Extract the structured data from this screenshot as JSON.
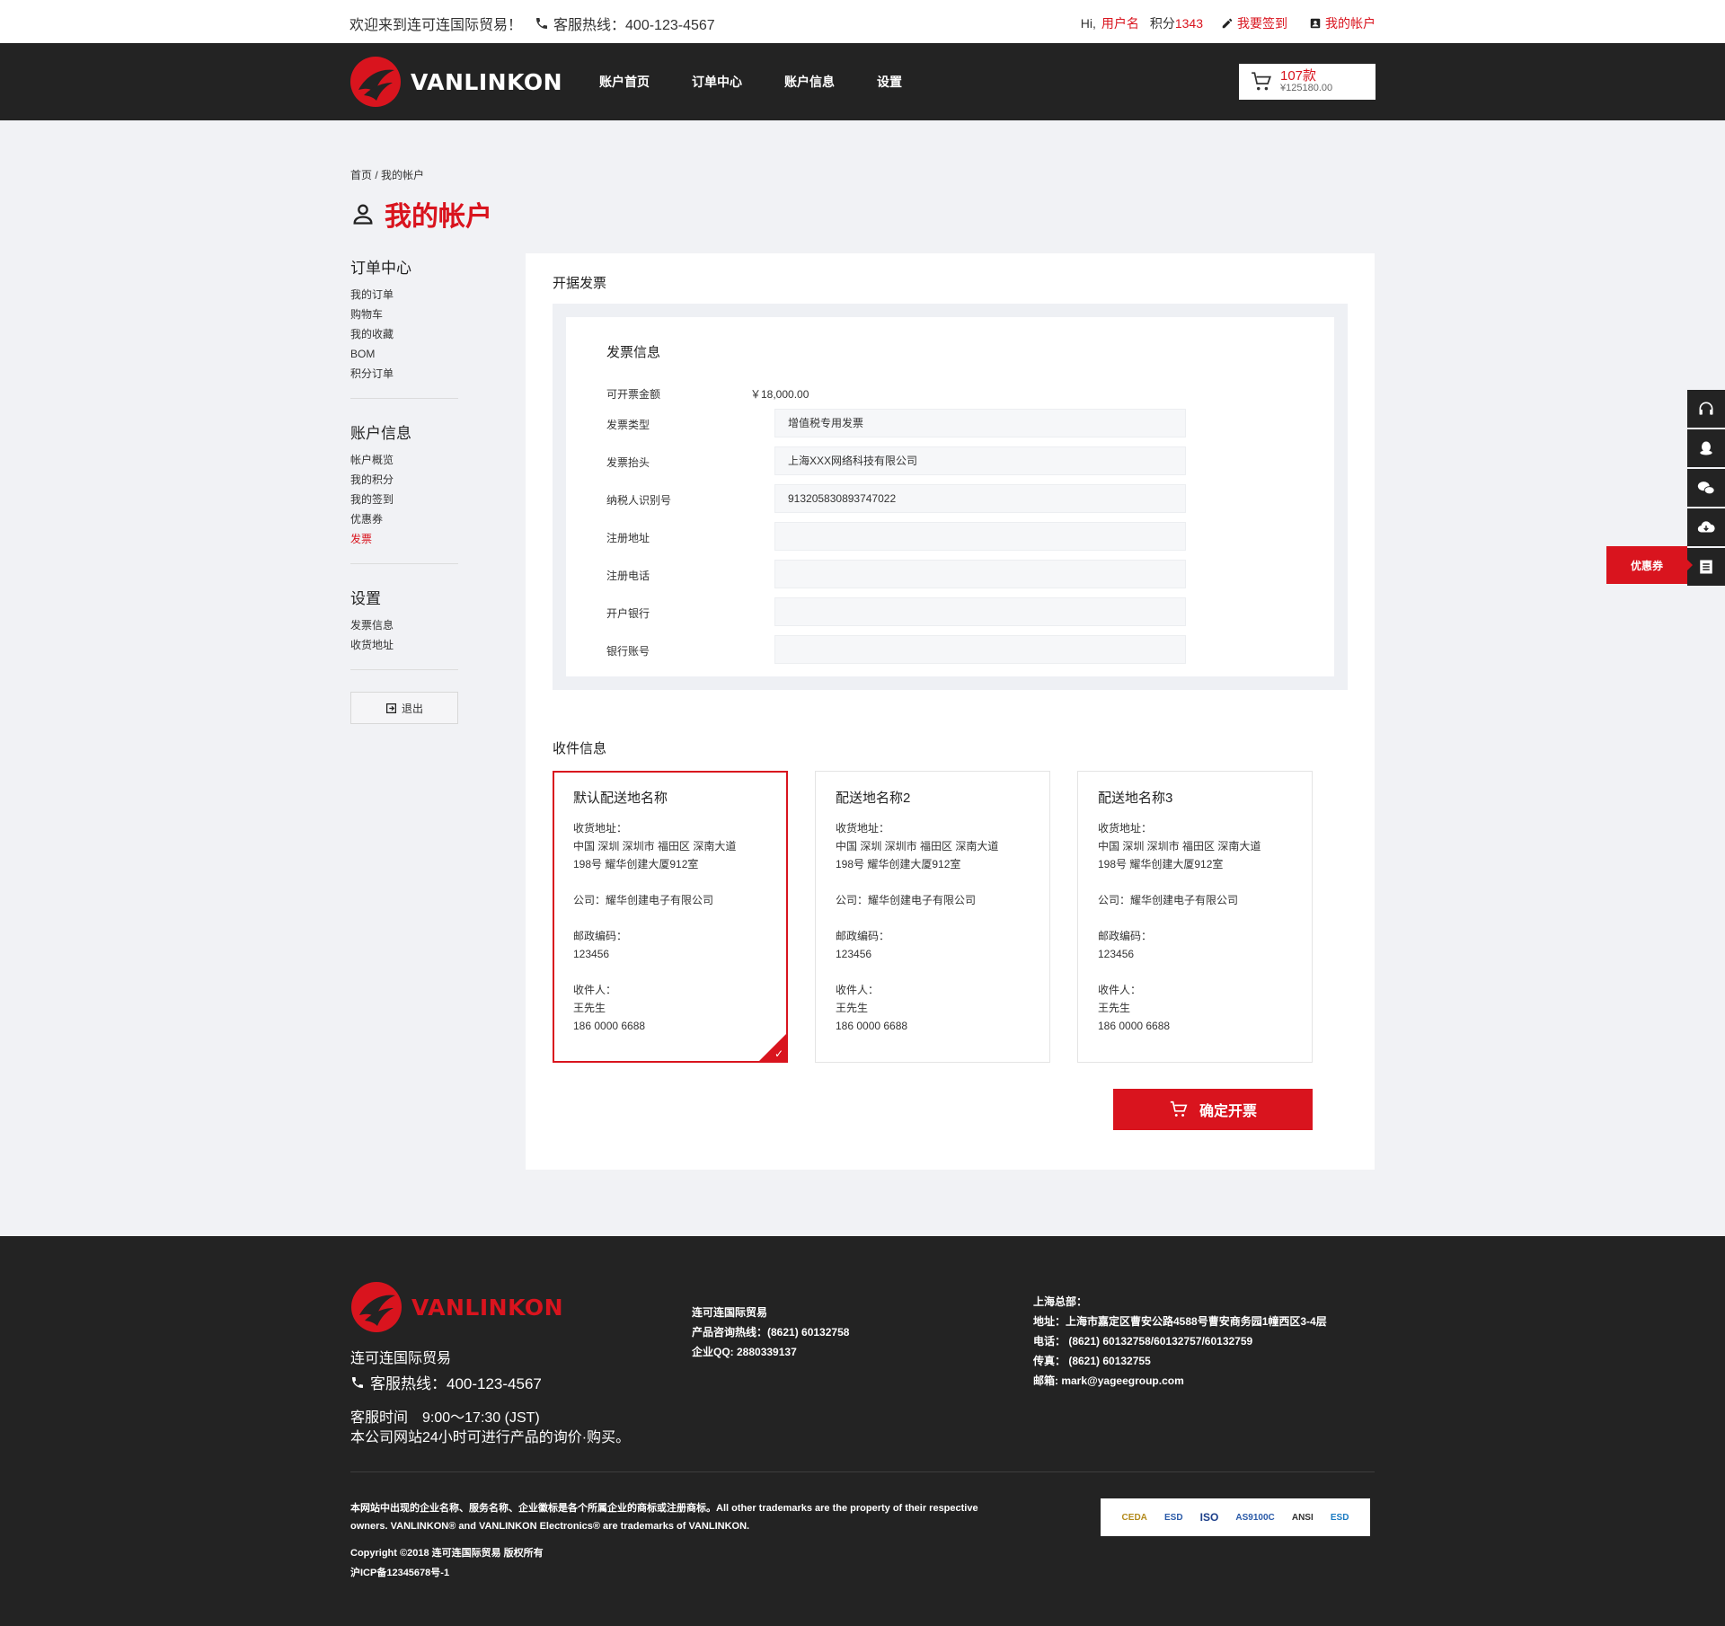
{
  "topbar": {
    "welcome": "欢迎来到连可连国际贸易！",
    "hotline": "客服热线：400-123-4567",
    "hi": "Hi,",
    "username": "用户名",
    "points_label": "积分",
    "points_value": "1343",
    "checkin": "我要签到",
    "my_account": "我的帐户"
  },
  "header": {
    "logo": "VANLINKON",
    "nav": [
      "账户首页",
      "订单中心",
      "账户信息",
      "设置"
    ],
    "cart_count": "107款",
    "cart_amount": "¥125180.00"
  },
  "breadcrumb": "首页 / 我的帐户",
  "page_title": "我的帐户",
  "sidebar": {
    "groups": [
      {
        "title": "订单中心",
        "items": [
          "我的订单",
          "购物车",
          "我的收藏",
          "BOM",
          "积分订单"
        ]
      },
      {
        "title": "账户信息",
        "items": [
          "帐户概览",
          "我的积分",
          "我的签到",
          "优惠券",
          "发票"
        ]
      },
      {
        "title": "设置",
        "items": [
          "发票信息",
          "收货地址"
        ]
      }
    ],
    "logout": "退出"
  },
  "panel": {
    "title": "开据发票",
    "invoice_title": "发票信息",
    "amount_label": "可开票金额",
    "amount_value": "￥18,000.00",
    "fields": [
      {
        "label": "发票类型",
        "value": "增值税专用发票"
      },
      {
        "label": "发票抬头",
        "value": "上海XXX网络科技有限公司"
      },
      {
        "label": "纳税人识别号",
        "value": "913205830893747022"
      },
      {
        "label": "注册地址",
        "value": ""
      },
      {
        "label": "注册电话",
        "value": ""
      },
      {
        "label": "开户银行",
        "value": ""
      },
      {
        "label": "银行账号",
        "value": ""
      }
    ],
    "shipping_title": "收件信息",
    "addresses": [
      {
        "name": "默认配送地名称",
        "addr_label": "收货地址：",
        "addr1": "中国 深圳 深圳市 福田区 深南大道",
        "addr2": "198号 耀华创建大厦912室",
        "company": "公司：耀华创建电子有限公司",
        "zip_label": "邮政编码：",
        "zip": "123456",
        "recv_label": "收件人：",
        "recv": "王先生",
        "phone": "186 0000 6688"
      },
      {
        "name": "配送地名称2",
        "addr_label": "收货地址：",
        "addr1": "中国 深圳 深圳市 福田区 深南大道",
        "addr2": "198号 耀华创建大厦912室",
        "company": "公司：耀华创建电子有限公司",
        "zip_label": "邮政编码：",
        "zip": "123456",
        "recv_label": "收件人：",
        "recv": "王先生",
        "phone": "186 0000 6688"
      },
      {
        "name": "配送地名称3",
        "addr_label": "收货地址：",
        "addr1": "中国 深圳 深圳市 福田区 深南大道",
        "addr2": "198号 耀华创建大厦912室",
        "company": "公司：耀华创建电子有限公司",
        "zip_label": "邮政编码：",
        "zip": "123456",
        "recv_label": "收件人：",
        "recv": "王先生",
        "phone": "186 0000 6688"
      }
    ],
    "confirm": "确定开票"
  },
  "float": {
    "coupon": "优惠券"
  },
  "footer": {
    "logo": "VANLINKON",
    "company": "连可连国际贸易",
    "hotline": "客服热线：400-123-4567",
    "hours": "客服时间　9:00～17:30 (JST)",
    "hours_note": "本公司网站24小时可进行产品的询价·购买。",
    "col2": [
      "连可连国际贸易",
      "产品咨询热线：(8621) 60132758",
      "企业QQ: 2880339137"
    ],
    "col3": [
      "上海总部：",
      "地址：上海市嘉定区曹安公路4588号曹安商务园1幢西区3-4层",
      "电话： (8621) 60132758/60132757/60132759",
      "传真： (8621) 60132755",
      "邮箱: mark@yageegroup.com"
    ],
    "legal1": "本网站中出现的企业名称、服务名称、企业徽标是各个所属企业的商标或注册商标。All other trademarks are the property of their respective",
    "legal2": "owners. VANLINKON® and VANLINKON Electronics® are trademarks of VANLINKON.",
    "copyright": "Copyright ©2018 连可连国际贸易 版权所有",
    "icp": "沪ICP备12345678号-1",
    "certs": [
      "CEDA",
      "ESD",
      "ISO",
      "AS9100C",
      "ANSI",
      "ESD"
    ]
  },
  "colors": {
    "accent": "#d9141e",
    "dark": "#232323",
    "bg": "#f1f2f5"
  }
}
